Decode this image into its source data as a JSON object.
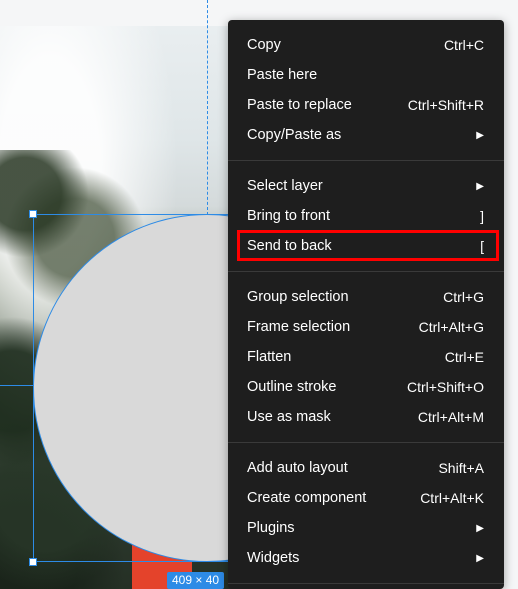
{
  "canvas": {
    "selection_size_label": "409 × 40"
  },
  "menu": {
    "groups": [
      [
        {
          "label": "Copy",
          "shortcut": "Ctrl+C"
        },
        {
          "label": "Paste here",
          "shortcut": ""
        },
        {
          "label": "Paste to replace",
          "shortcut": "Ctrl+Shift+R"
        },
        {
          "label": "Copy/Paste as",
          "shortcut": "▶"
        }
      ],
      [
        {
          "label": "Select layer",
          "shortcut": "▶"
        },
        {
          "label": "Bring to front",
          "shortcut": "]"
        },
        {
          "label": "Send to back",
          "shortcut": "["
        }
      ],
      [
        {
          "label": "Group selection",
          "shortcut": "Ctrl+G"
        },
        {
          "label": "Frame selection",
          "shortcut": "Ctrl+Alt+G"
        },
        {
          "label": "Flatten",
          "shortcut": "Ctrl+E"
        },
        {
          "label": "Outline stroke",
          "shortcut": "Ctrl+Shift+O"
        },
        {
          "label": "Use as mask",
          "shortcut": "Ctrl+Alt+M"
        }
      ],
      [
        {
          "label": "Add auto layout",
          "shortcut": "Shift+A"
        },
        {
          "label": "Create component",
          "shortcut": "Ctrl+Alt+K"
        },
        {
          "label": "Plugins",
          "shortcut": "▶"
        },
        {
          "label": "Widgets",
          "shortcut": "▶"
        }
      ]
    ],
    "highlighted_item": "Send to back"
  },
  "colors": {
    "menu_bg": "#1e1e1e",
    "selection_blue": "#2d8be6",
    "highlight_red": "#ff0000"
  }
}
